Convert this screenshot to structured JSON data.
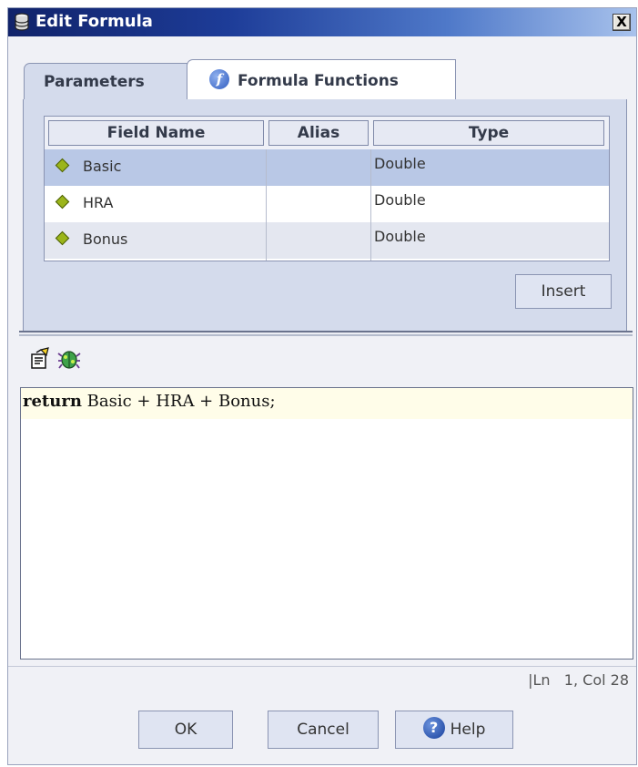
{
  "window": {
    "title": "Edit Formula",
    "close_label": "X"
  },
  "tabs": [
    {
      "label": "Parameters",
      "active": false
    },
    {
      "label": "Formula Functions",
      "active": true,
      "icon": "function-info-icon"
    }
  ],
  "grid": {
    "headers": [
      "Field Name",
      "Alias",
      "Type"
    ],
    "rows": [
      {
        "field": "Basic",
        "alias": "",
        "type": "Double",
        "selected": true
      },
      {
        "field": "HRA",
        "alias": "",
        "type": "Double",
        "selected": false
      },
      {
        "field": "Bonus",
        "alias": "",
        "type": "Double",
        "selected": false
      }
    ]
  },
  "insert_label": "Insert",
  "toolbar": {
    "icons": [
      "edit-formula-icon",
      "debug-bug-icon"
    ]
  },
  "editor": {
    "keyword": "return",
    "expression": " Basic + HRA + Bonus;"
  },
  "status": {
    "position": "|Ln   1, Col 28"
  },
  "buttons": {
    "ok": "OK",
    "cancel": "Cancel",
    "help": "Help"
  },
  "colors": {
    "title_start": "#11236a",
    "title_end": "#a8c2ec",
    "panel": "#d4dbec",
    "selected_row": "#b9c8e6",
    "editor_line": "#fffde9",
    "diamond": "#9bb51a"
  }
}
